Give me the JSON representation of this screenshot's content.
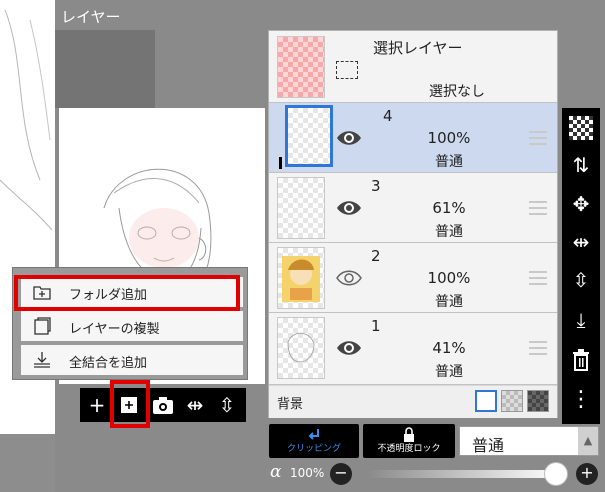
{
  "panel": {
    "title": "レイヤー"
  },
  "selection_layer": {
    "name": "選択レイヤー",
    "status": "選択なし"
  },
  "layers": [
    {
      "number": "4",
      "opacity": "100%",
      "mode": "普通"
    },
    {
      "number": "3",
      "opacity": "61%",
      "mode": "普通"
    },
    {
      "number": "2",
      "opacity": "100%",
      "mode": "普通"
    },
    {
      "number": "1",
      "opacity": "41%",
      "mode": "普通"
    }
  ],
  "background": {
    "label": "背景"
  },
  "popup_menu": {
    "items": [
      {
        "label": "フォルダ追加"
      },
      {
        "label": "レイヤーの複製"
      },
      {
        "label": "全結合を追加"
      }
    ]
  },
  "footer": {
    "clipping_label": "クリッピング",
    "lock_label": "不透明度ロック",
    "blend_mode": "普通",
    "alpha_symbol": "α",
    "alpha_value": "100%",
    "alpha_level": 1.0
  },
  "colors": {
    "selected_row": "#cdd9ee",
    "highlight_red": "#e00000",
    "accent_blue": "#2f76d6"
  },
  "icons": {
    "right_bar": [
      "transparency-checker-icon",
      "layer-swap-icon",
      "move-icon",
      "flip-horizontal-icon",
      "flip-vertical-icon",
      "merge-down-icon",
      "trash-icon",
      "more-icon"
    ],
    "bottom_bar": [
      "add-layer-icon",
      "add-folder-icon",
      "camera-icon",
      "flip-horizontal-icon",
      "flip-vertical-icon"
    ]
  }
}
